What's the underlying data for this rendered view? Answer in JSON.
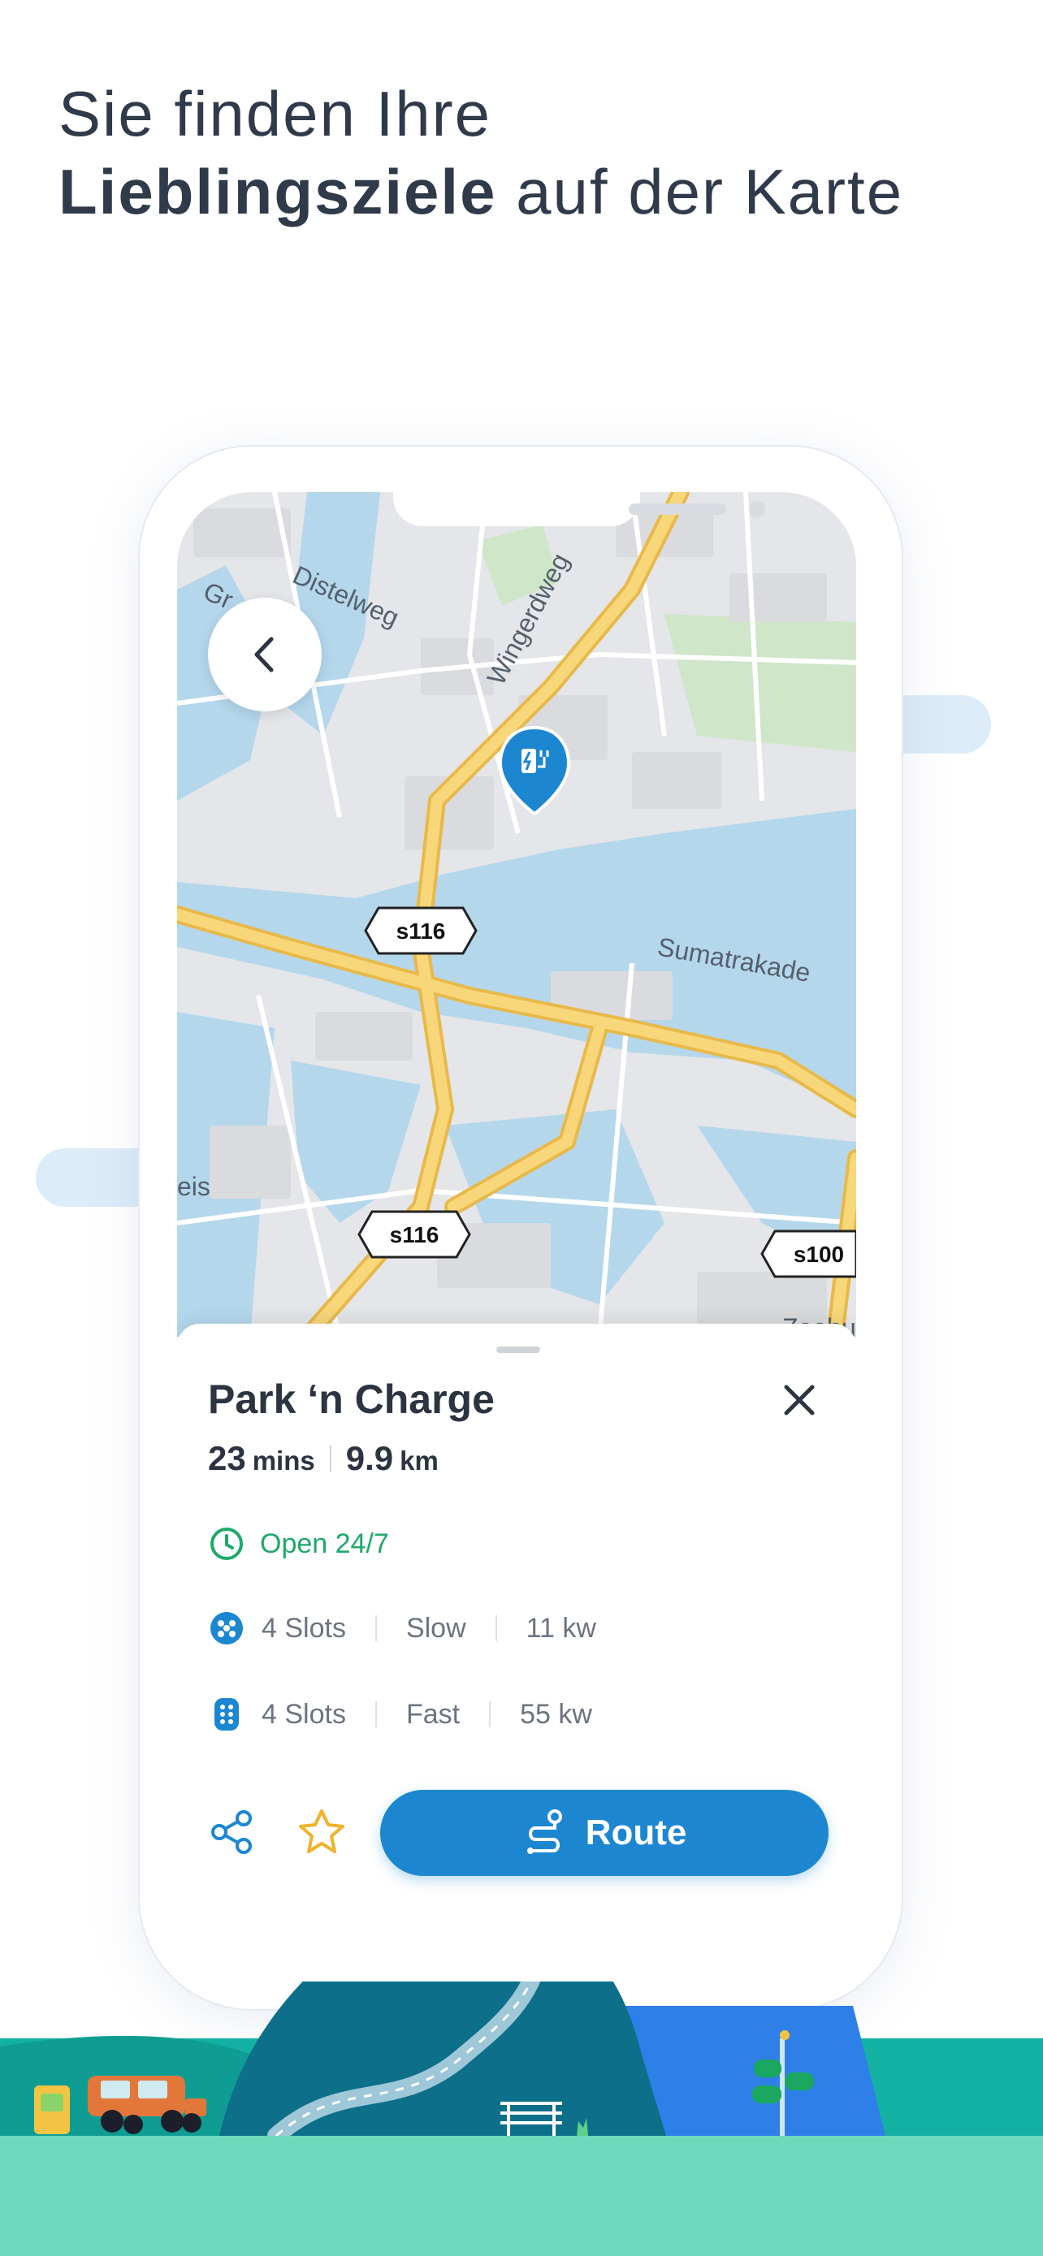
{
  "headline": {
    "line1": "Sie finden Ihre",
    "line2_bold": "Lieblingsziele",
    "line2_rest": " auf der Karte"
  },
  "map": {
    "street_labels": [
      "Distelweg",
      "Wingerdweg",
      "Sumatrakade",
      "Gr",
      "eis",
      "Zeebu"
    ],
    "road_shields": [
      "s116",
      "s116",
      "s100"
    ],
    "marker": "charging-station-icon"
  },
  "station": {
    "name": "Park ‘n Charge",
    "duration_value": "23",
    "duration_unit": "mins",
    "distance_value": "9.9",
    "distance_unit": "km",
    "opening": "Open 24/7",
    "slots": [
      {
        "count": "4 Slots",
        "speed": "Slow",
        "power": "11 kw"
      },
      {
        "count": "4 Slots",
        "speed": "Fast",
        "power": "55 kw"
      }
    ],
    "route_label": "Route"
  },
  "colors": {
    "primary": "#1c87d0",
    "open_green": "#1fa86a",
    "star": "#f1b22a",
    "water": "#b4d7ec",
    "road": "#f8d77a"
  }
}
